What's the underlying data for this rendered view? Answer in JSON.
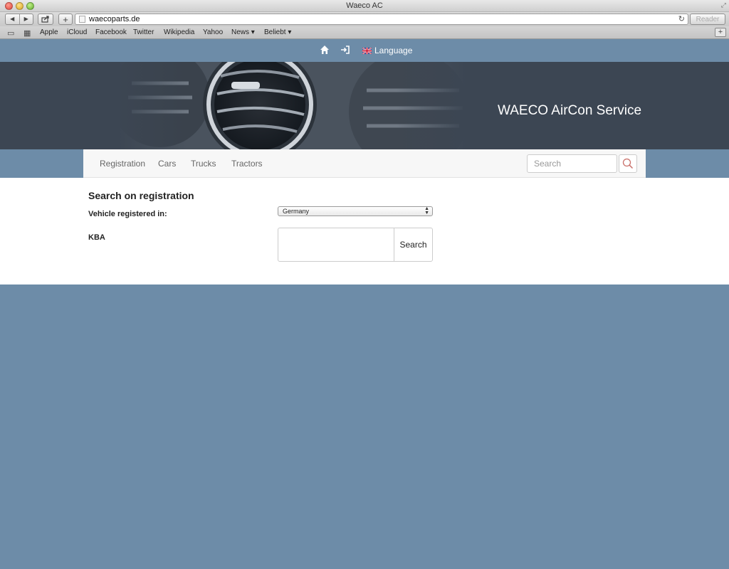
{
  "browser": {
    "window_title": "Waeco AC",
    "url": "waecoparts.de",
    "reader_label": "Reader",
    "bookmarks": [
      "Apple",
      "iCloud",
      "Facebook",
      "Twitter",
      "Wikipedia",
      "Yahoo",
      "News ▾",
      "Beliebt ▾"
    ]
  },
  "topbar": {
    "language_label": "Language",
    "icons": [
      "home-icon",
      "login-icon",
      "uk-flag-icon"
    ]
  },
  "banner": {
    "title": "WAECO AirCon Service"
  },
  "nav": {
    "items": [
      "Registration",
      "Cars",
      "Trucks",
      "Tractors"
    ],
    "search_placeholder": "Search"
  },
  "form": {
    "heading": "Search on registration",
    "vehicle_label": "Vehicle registered in:",
    "country_selected": "Germany",
    "kba_label": "KBA",
    "kba_value": "",
    "search_button": "Search"
  },
  "colors": {
    "page_background": "#6d8ca8",
    "banner_background": "#3c4653",
    "search_icon": "#c9706a"
  }
}
